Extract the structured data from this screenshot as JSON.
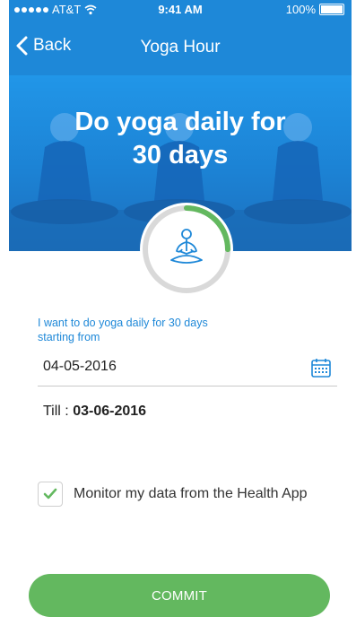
{
  "status_bar": {
    "carrier": "AT&T",
    "time": "9:41 AM",
    "battery": "100%",
    "icons": [
      "signal-dots-icon",
      "wifi-icon",
      "battery-icon"
    ]
  },
  "nav": {
    "back_label": "Back",
    "title": "Yoga Hour"
  },
  "hero": {
    "title_line1": "Do yoga daily for",
    "title_line2": "30 days"
  },
  "progress": {
    "fraction": 0.25,
    "icon": "meditation-icon"
  },
  "form": {
    "prompt_line1": "I want to do yoga daily for 30 days",
    "prompt_line2": "starting from",
    "start_date": "04-05-2016",
    "till_label": "Till : ",
    "till_date": "03-06-2016",
    "monitor_checked": true,
    "monitor_label": "Monitor my data from the Health App"
  },
  "commit_label": "COMMIT",
  "colors": {
    "primary_blue": "#1e88d8",
    "accent_green": "#63b85f",
    "ring_track": "#d9d9d9"
  }
}
